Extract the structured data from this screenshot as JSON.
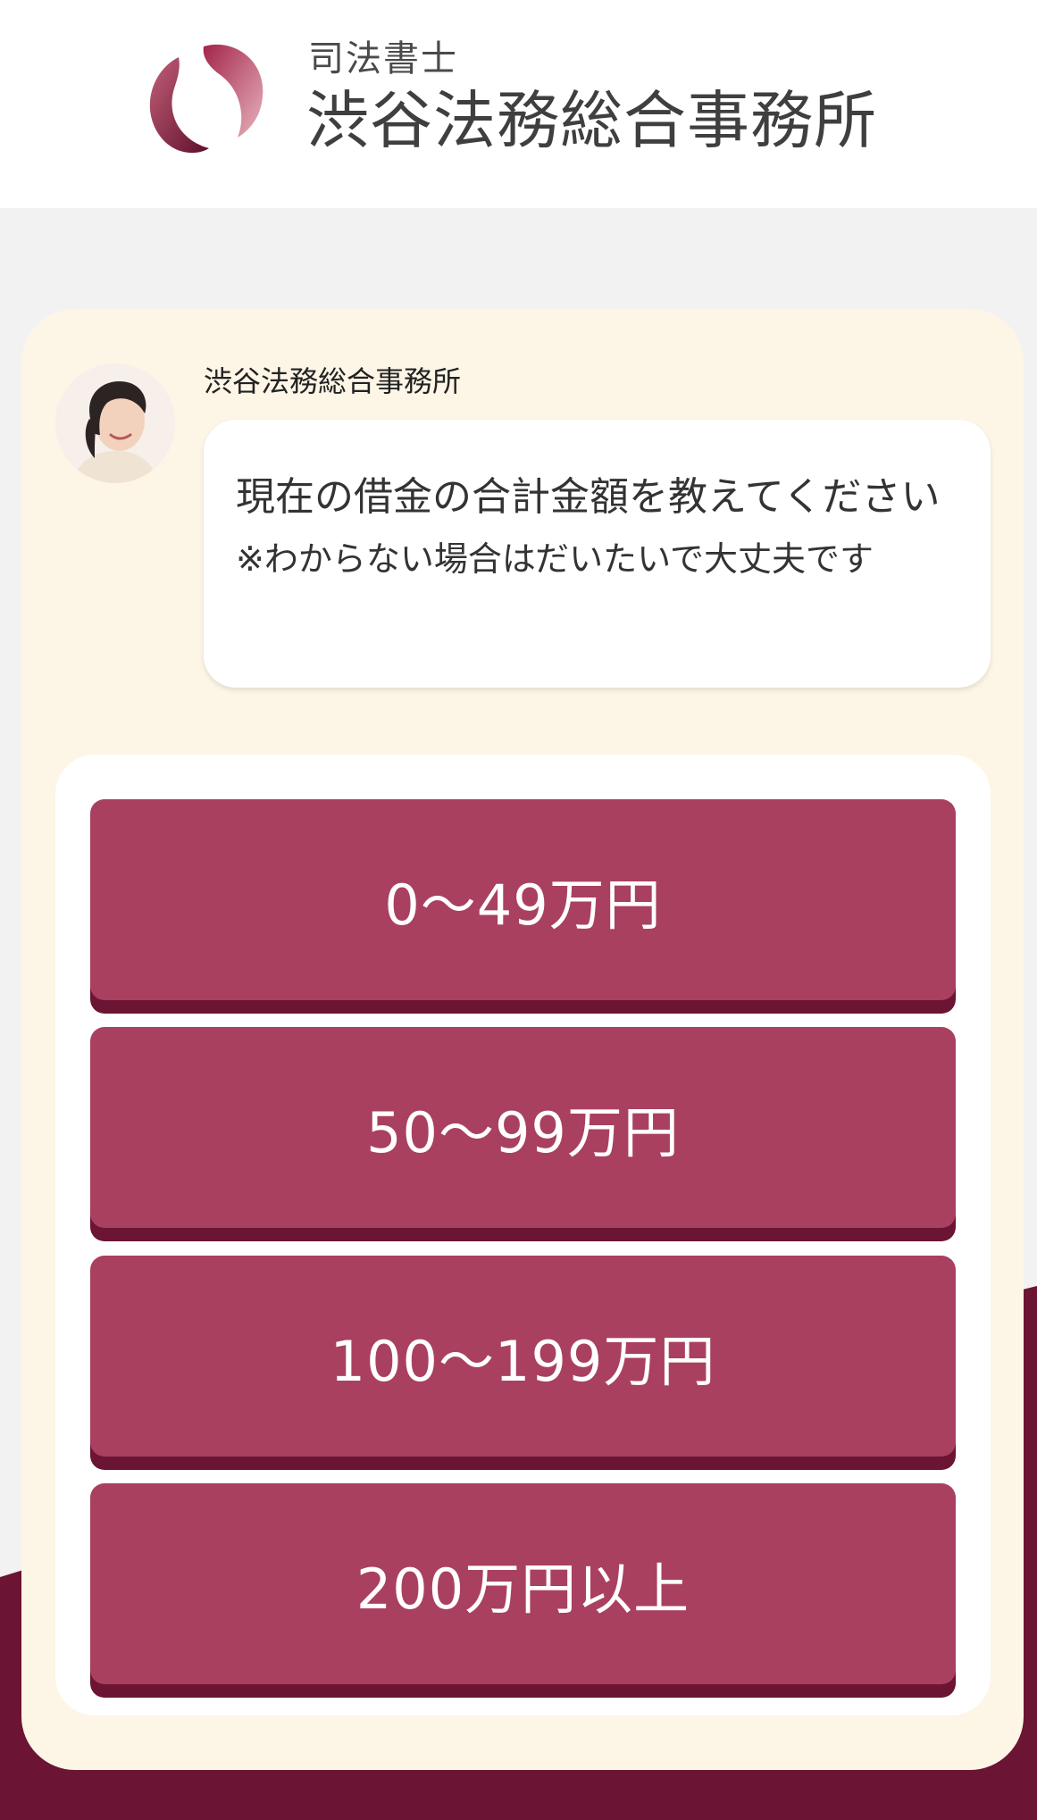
{
  "header": {
    "logo_subtitle": "司法書士",
    "logo_title": "渋谷法務総合事務所"
  },
  "chat": {
    "sender_name": "渋谷法務総合事務所",
    "message": "現在の借金の合計金額を教えてください",
    "note": "※わからない場合はだいたいで大丈夫です"
  },
  "options": [
    {
      "label": "0～49万円"
    },
    {
      "label": "50～99万円"
    },
    {
      "label": "100～199万円"
    },
    {
      "label": "200万円以上"
    }
  ],
  "colors": {
    "brand": "#6b1433",
    "button": "#a9405f",
    "card_bg": "#fdf5e6",
    "page_bg": "#f2f2f2"
  }
}
